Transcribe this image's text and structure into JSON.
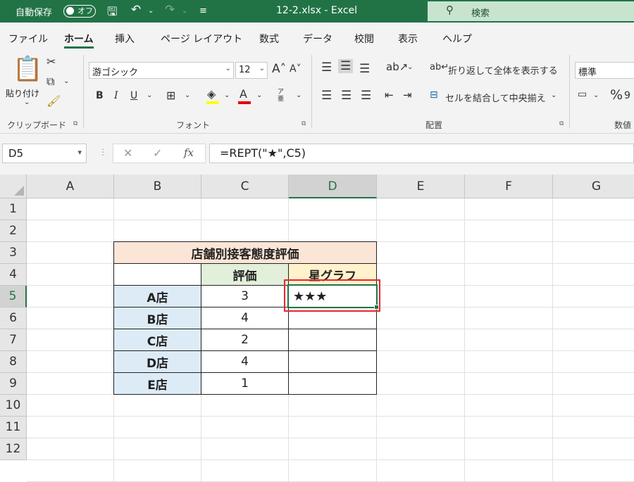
{
  "titlebar": {
    "autosave_label": "自動保存",
    "autosave_state": "オフ",
    "title": "12-2.xlsx  -  Excel",
    "search_placeholder": "検索"
  },
  "menu": [
    "ファイル",
    "ホーム",
    "挿入",
    "ページ レイアウト",
    "数式",
    "データ",
    "校閲",
    "表示",
    "ヘルプ"
  ],
  "menu_active": "ホーム",
  "ribbon": {
    "clipboard": {
      "paste_label": "貼り付け",
      "group_label": "クリップボード"
    },
    "font": {
      "font_name": "游ゴシック",
      "font_size": "12",
      "group_label": "フォント",
      "bold": "B",
      "italic": "I",
      "underline": "U",
      "font_color_glyph": "A",
      "phonetic": "ア亜"
    },
    "alignment": {
      "wrap_text": "折り返して全体を表示する",
      "merge_center": "セルを結合して中央揃え",
      "group_label": "配置"
    },
    "number": {
      "format": "標準",
      "group_label": "数値",
      "percent": "%"
    },
    "colors": {
      "accent": "#217346",
      "font_color_bar": "#e00000",
      "fill_color_bar": "#ffff00"
    }
  },
  "formula_bar": {
    "name_box": "D5",
    "formula": "=REPT(\"★\",C5)",
    "fx": "fx"
  },
  "grid": {
    "columns": [
      "A",
      "B",
      "C",
      "D",
      "E",
      "F",
      "G"
    ],
    "rows": [
      "1",
      "2",
      "3",
      "4",
      "5",
      "6",
      "7",
      "8",
      "9",
      "10",
      "11",
      "12"
    ],
    "selected_column": "D",
    "selected_row": "5"
  },
  "table": {
    "title": "店舗別接客態度評価",
    "header_rating": "評価",
    "header_graph": "星グラフ",
    "rows": [
      {
        "store": "A店",
        "rating": "3",
        "graph": "★★★"
      },
      {
        "store": "B店",
        "rating": "4",
        "graph": ""
      },
      {
        "store": "C店",
        "rating": "2",
        "graph": ""
      },
      {
        "store": "D店",
        "rating": "4",
        "graph": ""
      },
      {
        "store": "E店",
        "rating": "1",
        "graph": ""
      }
    ],
    "colors": {
      "title_fill": "#fbe5d6",
      "rating_header_fill": "#e2efda",
      "graph_header_fill": "#fff2cc",
      "store_fill": "#ddebf7",
      "highlight": "#e8262c"
    }
  }
}
